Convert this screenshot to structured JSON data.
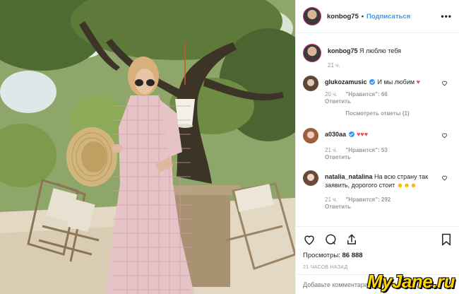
{
  "header": {
    "username": "konbog75",
    "separator": "•",
    "follow_label": "Подписаться",
    "more_icon": "more-horizontal-icon"
  },
  "caption": {
    "username": "konbog75",
    "text": "Я люблю тебя",
    "time": "21 ч."
  },
  "comments": [
    {
      "username": "glukozamusic",
      "verified": true,
      "text": "И мы любим",
      "emoji": "♥",
      "time": "20 ч.",
      "likes": "\"Нравится\": 66",
      "reply": "Ответить",
      "view_replies": "Посмотреть ответы (1)"
    },
    {
      "username": "a030aa",
      "verified": true,
      "text": "",
      "emoji": "♥♥♥",
      "time": "21 ч.",
      "likes": "\"Нравится\": 53",
      "reply": "Ответить"
    },
    {
      "username": "natalia_natalina",
      "verified": false,
      "text": "На всю страну так заявить, дорогого стоит",
      "emoji": "☻☻☻",
      "time": "21 ч.",
      "likes": "\"Нравится\": 292",
      "reply": "Ответить"
    }
  ],
  "actions": {
    "like_icon": "heart-icon",
    "comment_icon": "comment-icon",
    "share_icon": "share-icon",
    "save_icon": "bookmark-icon",
    "views_label": "Просмотры:",
    "views_count": "86 888",
    "timestamp": "21 ЧАСОВ НАЗАД"
  },
  "add_comment": {
    "placeholder": "Добавьте комментарий..."
  },
  "watermark": "MyJane.ru",
  "colors": {
    "accent": "#3897f0",
    "heart": "#ed4956",
    "muted": "#999999"
  }
}
